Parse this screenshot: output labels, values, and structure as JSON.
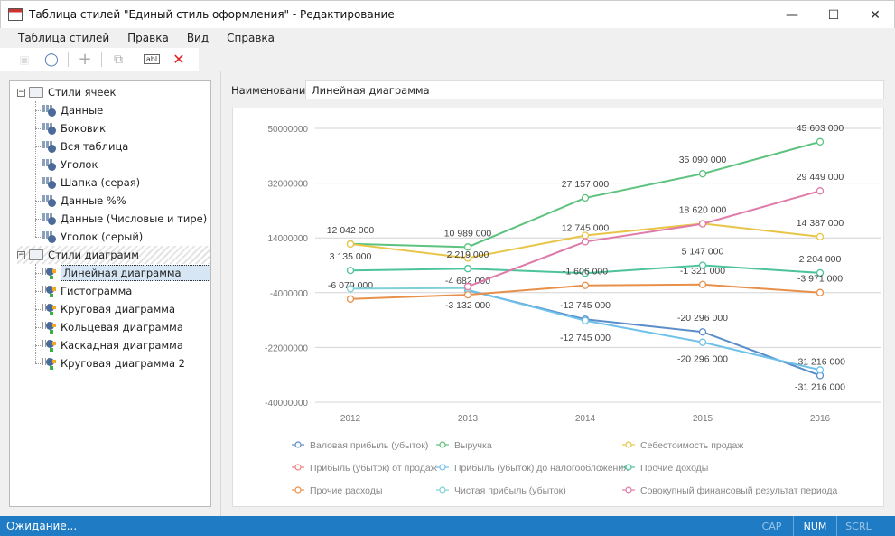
{
  "window": {
    "title": "Таблица стилей \"Единый стиль оформления\" - Редактирование",
    "minimize": "—",
    "maximize": "☐",
    "close": "✕"
  },
  "menu": [
    "Таблица стилей",
    "Правка",
    "Вид",
    "Справка"
  ],
  "toolbar": {
    "save": "💾",
    "find": "🔍",
    "add": "+",
    "copy": "⧉",
    "rename": "abl",
    "delete": "✕",
    "delete_color": "#e02020"
  },
  "tree": {
    "groups": [
      {
        "label": "Стили ячеек",
        "toggle": "−",
        "items": [
          "Данные",
          "Боковик",
          "Вся таблица",
          "Уголок",
          "Шапка (серая)",
          "Данные %%",
          "Данные (Числовые и тире)",
          "Уголок (серый)"
        ]
      },
      {
        "label": "Стили диаграмм",
        "toggle": "−",
        "items": [
          "Линейная диаграмма",
          "Гистограмма",
          "Круговая диаграмма",
          "Кольцевая диаграмма",
          "Каскадная диаграмма",
          "Круговая диаграмма 2"
        ],
        "selected": 0
      }
    ]
  },
  "form": {
    "name_label": "Наименование:",
    "name_value": "Линейная диаграмма"
  },
  "chart_data": {
    "type": "line",
    "categories": [
      "2012",
      "2013",
      "2014",
      "2015",
      "2016"
    ],
    "ylim": [
      -40000000,
      50000000
    ],
    "yticks": [
      50000000,
      32000000,
      14000000,
      -4000000,
      -22000000,
      -40000000
    ],
    "ytick_labels": [
      "50000000",
      "32000000",
      "14000000",
      "-4000000",
      "-22000000",
      "-40000000"
    ],
    "grid": true,
    "legend_position": "bottom",
    "series": [
      {
        "name": "Валовая прибыль (убыток)",
        "color": "#5b8ec8",
        "values": [
          null,
          -3200000,
          -12745000,
          -16900000,
          -31216000
        ],
        "labels": [
          null,
          null,
          "-12 745 000",
          "-20 296 000",
          "-31 216 000"
        ],
        "label_position": "above"
      },
      {
        "name": "Выручка",
        "color": "#5cc27d",
        "values": [
          12042000,
          10989000,
          27157000,
          35090000,
          45603000
        ],
        "labels": [
          "12 042 000",
          "10 989 000",
          "27 157 000",
          "35 090 000",
          "45 603 000"
        ],
        "label_position": "above"
      },
      {
        "name": "Себестоимость продаж",
        "color": "#e8c547",
        "values": [
          12000000,
          7400000,
          14800000,
          18700000,
          14387000
        ],
        "labels": [
          null,
          null,
          null,
          null,
          "14 387 000"
        ],
        "label_position": "above"
      },
      {
        "name": "Прибыль (убыток) от продаж",
        "color": "#f08080",
        "values": [
          null,
          null,
          null,
          null,
          null
        ],
        "labels": [
          null,
          null,
          null,
          null,
          null
        ],
        "label_position": "above"
      },
      {
        "name": "Прибыль (убыток) до налогообложения",
        "color": "#6ec1ea",
        "values": [
          null,
          -3100000,
          -13200000,
          -20296000,
          -29400000
        ],
        "labels": [
          null,
          null,
          "-12 745 000",
          "-20 296 000",
          "-31 216 000"
        ],
        "label_position": "below"
      },
      {
        "name": "Прочие доходы",
        "color": "#4cc39a",
        "values": [
          3300000,
          3900000,
          2400000,
          5000000,
          2500000
        ],
        "labels": [
          "3 135 000",
          "2 219 000",
          null,
          "5 147 000",
          "2 204 000"
        ],
        "label_position": "above"
      },
      {
        "name": "Прочие расходы",
        "color": "#e8904a",
        "values": [
          -6079000,
          -4682000,
          -1606000,
          -1321000,
          -3971000
        ],
        "labels": [
          "-6 079 000",
          "-4 682 000",
          "-1 606 000",
          "-1 321 000",
          "-3 971 000"
        ],
        "label_position": "above"
      },
      {
        "name": "Чистая прибыль (убыток)",
        "color": "#7fd0d8",
        "values": [
          -2700000,
          -2500000,
          null,
          null,
          null
        ],
        "labels": [
          null,
          "-3 132 000",
          null,
          null,
          null
        ],
        "label_position": "below"
      },
      {
        "name": "Совокупный финансовый результат периода",
        "color": "#e07aa8",
        "values": [
          null,
          -2000000,
          12745000,
          18620000,
          29449000
        ],
        "labels": [
          null,
          null,
          "12 745 000",
          "18 620 000",
          "29 449 000"
        ],
        "label_position": "above"
      }
    ]
  },
  "status": {
    "text": "Ожидание...",
    "cap": "CAP",
    "num": "NUM",
    "scrl": "SCRL"
  }
}
